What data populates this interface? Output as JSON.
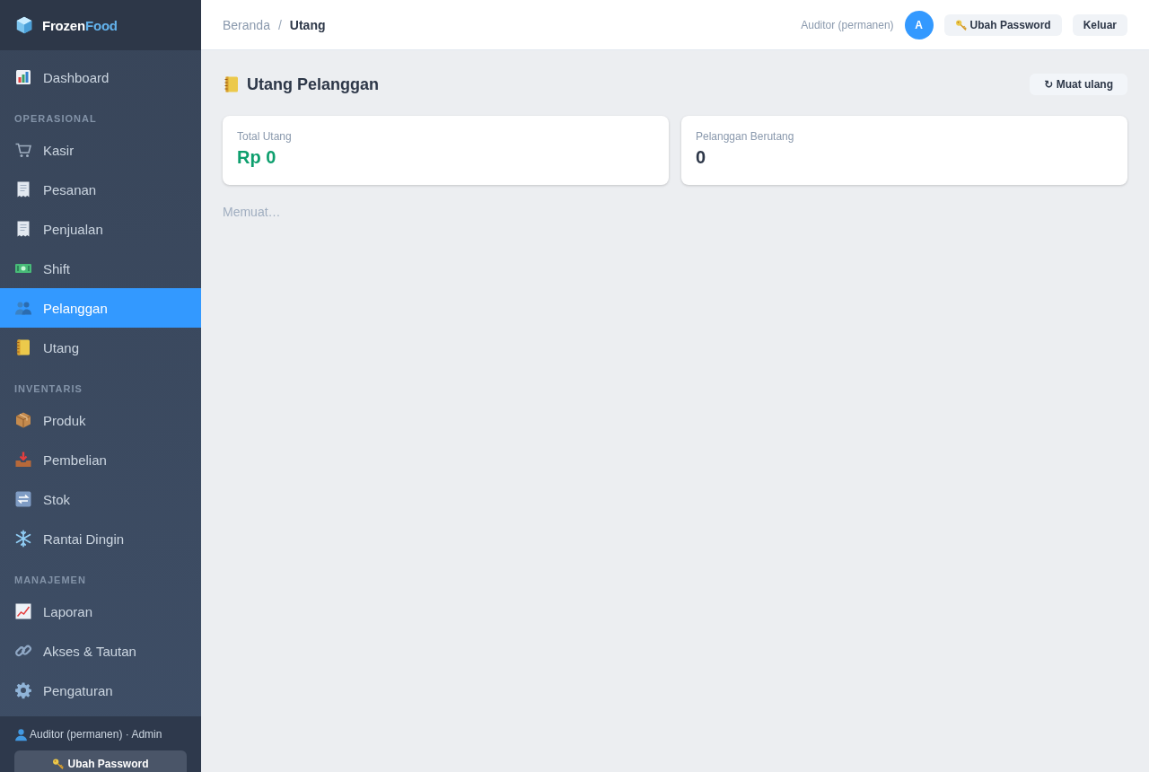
{
  "sidebar": {
    "brand": {
      "text_1": "Frozen",
      "text_2": "Food"
    },
    "items": [
      {
        "label": "Dashboard",
        "selected": false
      }
    ],
    "sections": [
      {
        "heading": "OPERASIONAL",
        "items": [
          {
            "label": "Kasir",
            "selected": false
          },
          {
            "label": "Pesanan",
            "selected": false
          },
          {
            "label": "Penjualan",
            "selected": false
          },
          {
            "label": "Shift",
            "selected": false
          },
          {
            "label": "Pelanggan",
            "selected": true
          },
          {
            "label": "Utang",
            "selected": false
          }
        ]
      },
      {
        "heading": "INVENTARIS",
        "items": [
          {
            "label": "Produk",
            "selected": false
          },
          {
            "label": "Pembelian",
            "selected": false
          },
          {
            "label": "Stok",
            "selected": false
          },
          {
            "label": "Rantai Dingin",
            "selected": false
          }
        ]
      },
      {
        "heading": "MANAJEMEN",
        "items": [
          {
            "label": "Laporan",
            "selected": false
          },
          {
            "label": "Akses & Tautan",
            "selected": false
          },
          {
            "label": "Pengaturan",
            "selected": false
          }
        ]
      }
    ],
    "footer": {
      "user": "Auditor (permanen) · Admin",
      "button": "Ubah Password"
    }
  },
  "topbar": {
    "breadcrumb": [
      {
        "label": "Beranda",
        "current": false
      },
      {
        "label": "Utang",
        "current": true
      }
    ],
    "separator": "/",
    "user_name": "Auditor (permanen)",
    "avatar": "A",
    "buttons": [
      {
        "label": "Ubah Password",
        "kind": "key"
      },
      {
        "label": "Keluar",
        "kind": "plain"
      }
    ]
  },
  "page": {
    "title": "Utang Pelanggan",
    "reload_button": "↻ Muat ulang",
    "cards": [
      {
        "label": "Total Utang",
        "value": "Rp 0",
        "color": "#0e9f6e"
      },
      {
        "label": "Pelanggan Berutang",
        "value": "0",
        "color": "#2d3748"
      }
    ],
    "status": "Memuat…"
  }
}
